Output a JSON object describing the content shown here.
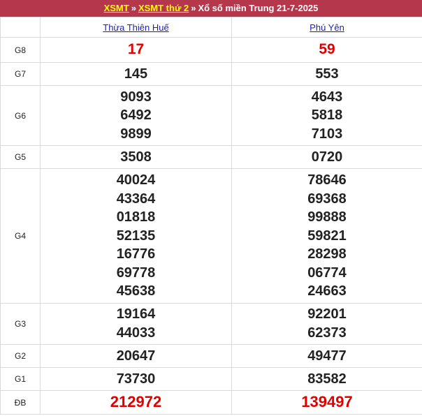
{
  "header": {
    "link1": "XSMT",
    "sep1": "»",
    "link2": "XSMT thứ 2",
    "sep2": "»",
    "title": "Xổ số miền Trung 21-7-2025"
  },
  "provinces": [
    "Thừa Thiên Huế",
    "Phú Yên"
  ],
  "prizes": [
    {
      "label": "G8",
      "p1": [
        "17"
      ],
      "p2": [
        "59"
      ]
    },
    {
      "label": "G7",
      "p1": [
        "145"
      ],
      "p2": [
        "553"
      ]
    },
    {
      "label": "G6",
      "p1": [
        "9093",
        "6492",
        "9899"
      ],
      "p2": [
        "4643",
        "5818",
        "7103"
      ]
    },
    {
      "label": "G5",
      "p1": [
        "3508"
      ],
      "p2": [
        "0720"
      ]
    },
    {
      "label": "G4",
      "p1": [
        "40024",
        "43364",
        "01818",
        "52135",
        "16776",
        "69778",
        "45638"
      ],
      "p2": [
        "78646",
        "69368",
        "99888",
        "59821",
        "28298",
        "06774",
        "24663"
      ]
    },
    {
      "label": "G3",
      "p1": [
        "19164",
        "44033"
      ],
      "p2": [
        "92201",
        "62373"
      ]
    },
    {
      "label": "G2",
      "p1": [
        "20647"
      ],
      "p2": [
        "49477"
      ]
    },
    {
      "label": "G1",
      "p1": [
        "73730"
      ],
      "p2": [
        "83582"
      ]
    },
    {
      "label": "ĐB",
      "p1": [
        "212972"
      ],
      "p2": [
        "139497"
      ]
    }
  ]
}
